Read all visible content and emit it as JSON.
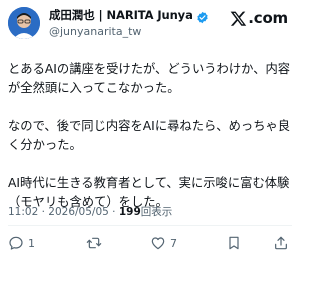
{
  "author": {
    "display_name": "成田潤也 | NARITA Junya",
    "handle": "@junyanarita_tw",
    "verified": true
  },
  "brand": {
    "text": ".com",
    "icon": "x-logo-icon"
  },
  "tweet": {
    "paragraphs": [
      [
        "とあるAIの講座を受けたが、どういうわけか、内容",
        "が全然頭に入ってこなかった。"
      ],
      [
        "なので、後で同じ内容をAIに尋ねたら、めっちゃ良",
        "く分かった。"
      ],
      [
        "AI時代に生きる教育者として、実に示唆に富む体験",
        "（モヤリも含めて）をした。"
      ]
    ],
    "time": "11:02",
    "separator": "·",
    "date": "2026/05/05",
    "views_count": "199",
    "views_label": "回表示"
  },
  "actions": {
    "reply_count": "1",
    "retweet_count": "",
    "like_count": "7"
  },
  "colors": {
    "text": "#0f1419",
    "secondary": "#536471",
    "verified": "#1d9bf0",
    "avatar_bg": "#2b6cc4"
  }
}
